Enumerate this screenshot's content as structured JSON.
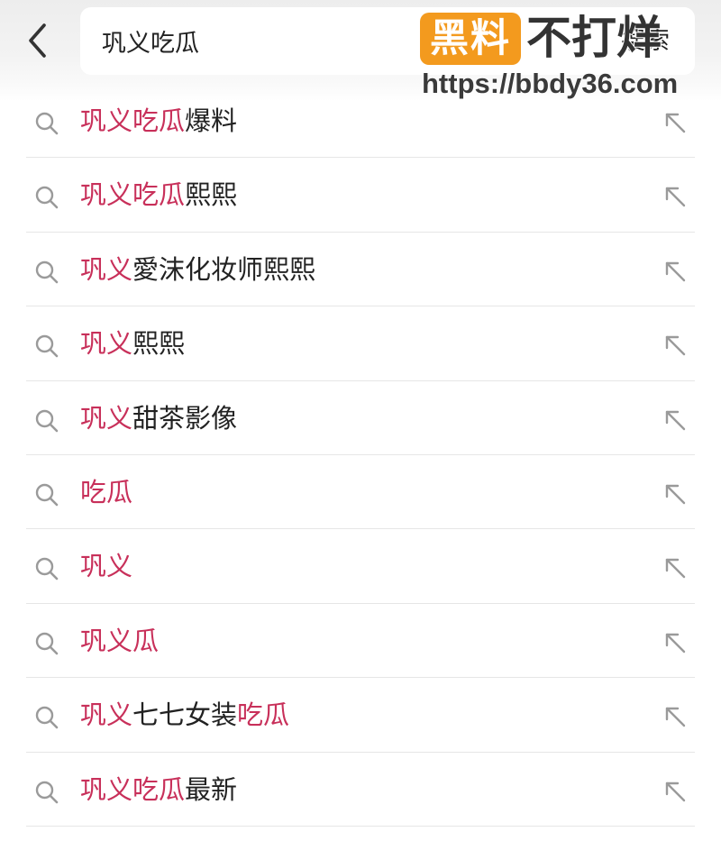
{
  "header": {
    "back_label": "back",
    "search_value": "巩义吃瓜",
    "search_button_label": "搜索"
  },
  "watermark": {
    "badge": "黑料",
    "text": "不打烊",
    "url": "https://bbdy36.com"
  },
  "colors": {
    "highlight": "#c8305a",
    "text": "#222222",
    "icon": "#9a9a9a",
    "divider": "#e6e6e6",
    "watermark_badge": "#f39a1e"
  },
  "icons": {
    "back": "chevron-left-icon",
    "row_leading": "search-icon",
    "row_trailing": "arrow-up-left-icon"
  },
  "suggestions": [
    {
      "segments": [
        {
          "text": "巩义吃瓜",
          "highlight": true
        },
        {
          "text": "爆料",
          "highlight": false
        }
      ]
    },
    {
      "segments": [
        {
          "text": "巩义吃瓜",
          "highlight": true
        },
        {
          "text": "熙熙",
          "highlight": false
        }
      ]
    },
    {
      "segments": [
        {
          "text": "巩义",
          "highlight": true
        },
        {
          "text": "愛沫化妆师熙熙",
          "highlight": false
        }
      ]
    },
    {
      "segments": [
        {
          "text": "巩义",
          "highlight": true
        },
        {
          "text": "熙熙",
          "highlight": false
        }
      ]
    },
    {
      "segments": [
        {
          "text": "巩义",
          "highlight": true
        },
        {
          "text": "甜茶影像",
          "highlight": false
        }
      ]
    },
    {
      "segments": [
        {
          "text": "吃瓜",
          "highlight": true
        }
      ]
    },
    {
      "segments": [
        {
          "text": "巩义",
          "highlight": true
        }
      ]
    },
    {
      "segments": [
        {
          "text": "巩义瓜",
          "highlight": true
        }
      ]
    },
    {
      "segments": [
        {
          "text": "巩义",
          "highlight": true
        },
        {
          "text": "七七女装",
          "highlight": false
        },
        {
          "text": "吃瓜",
          "highlight": true
        }
      ]
    },
    {
      "segments": [
        {
          "text": "巩义吃瓜",
          "highlight": true
        },
        {
          "text": "最新",
          "highlight": false
        }
      ]
    }
  ]
}
